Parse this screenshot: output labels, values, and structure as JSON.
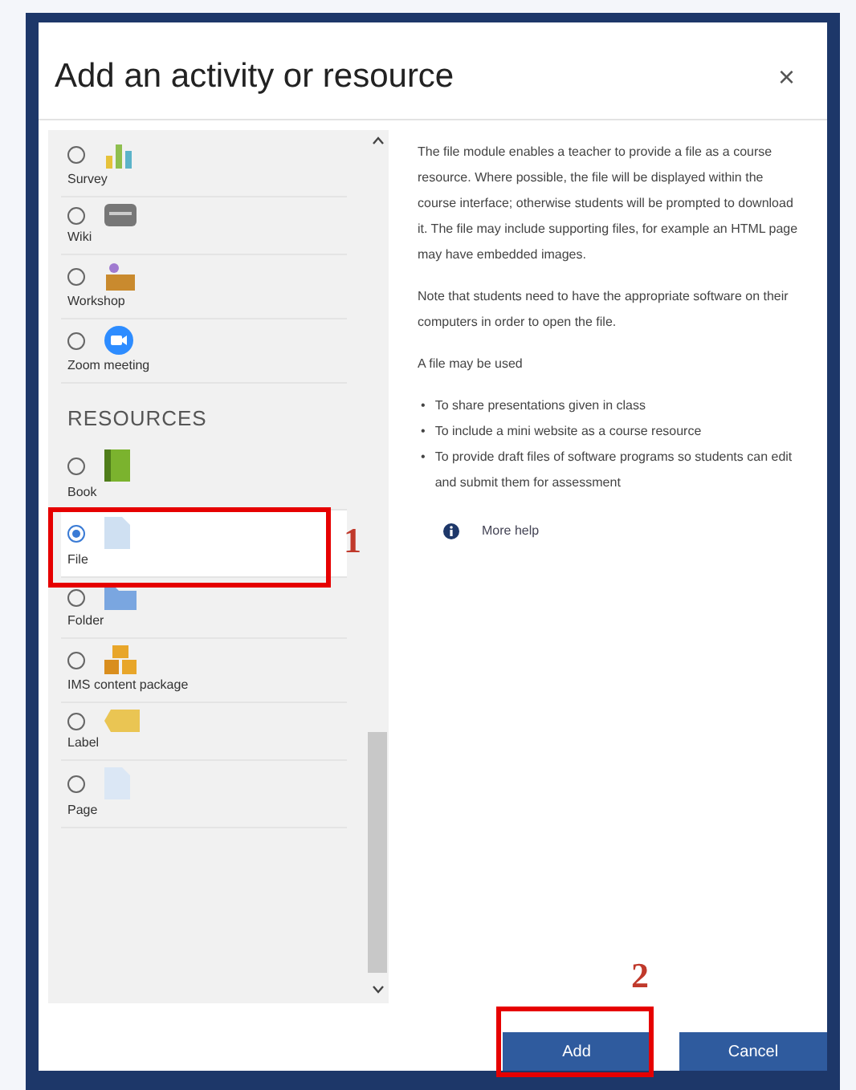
{
  "dialog": {
    "title": "Add an activity or resource",
    "close": "×"
  },
  "items": [
    {
      "kind": "item",
      "label": "Survey",
      "selected": false
    },
    {
      "kind": "item",
      "label": "Wiki",
      "selected": false
    },
    {
      "kind": "item",
      "label": "Workshop",
      "selected": false
    },
    {
      "kind": "item",
      "label": "Zoom meeting",
      "selected": false
    },
    {
      "kind": "heading",
      "label": "RESOURCES"
    },
    {
      "kind": "item",
      "label": "Book",
      "selected": false
    },
    {
      "kind": "item",
      "label": "File",
      "selected": true
    },
    {
      "kind": "item",
      "label": "Folder",
      "selected": false
    },
    {
      "kind": "item",
      "label": "IMS content package",
      "selected": false
    },
    {
      "kind": "item",
      "label": "Label",
      "selected": false
    },
    {
      "kind": "item",
      "label": "Page",
      "selected": false
    }
  ],
  "description": {
    "paragraphs": [
      "The file module enables a teacher to provide a file as a course resource. Where possible, the file will be displayed within the course interface; otherwise students will be prompted to download it. The file may include supporting files, for example an HTML page may have embedded images.",
      "Note that students need to have the appropriate software on their computers in order to open the file.",
      "A file may be used"
    ],
    "bullets": [
      {
        "marker": "•",
        "text": "To share presentations given in class"
      },
      {
        "marker": "•",
        "text": "To include a mini website as a course resource"
      },
      {
        "marker": "•",
        "text": "To provide draft files of software programs so students can edit and submit them for assessment"
      }
    ],
    "help": "More help"
  },
  "buttons": [
    {
      "label": "Add",
      "annotation": "2"
    },
    {
      "label": "Cancel"
    }
  ],
  "item_annotation": "1"
}
